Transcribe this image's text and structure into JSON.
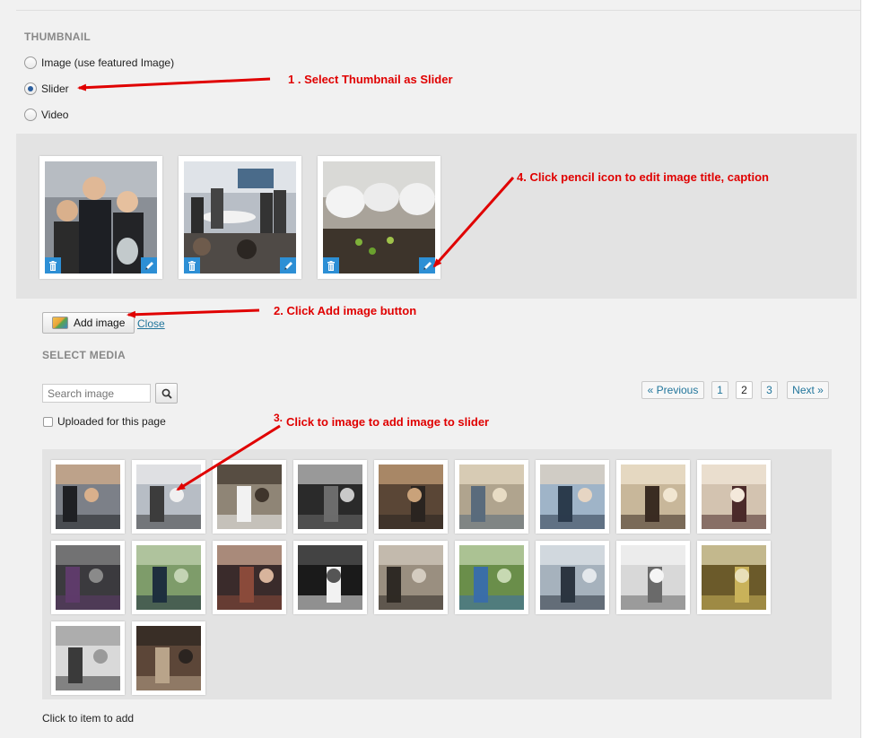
{
  "thumbnail": {
    "title": "THUMBNAIL",
    "options": [
      {
        "label": "Image (use featured Image)",
        "checked": false
      },
      {
        "label": "Slider",
        "checked": true
      },
      {
        "label": "Video",
        "checked": false
      }
    ]
  },
  "slider": {
    "items": [
      {
        "icon": "photo-scientists"
      },
      {
        "icon": "photo-group-meeting"
      },
      {
        "icon": "photo-students-planting"
      }
    ],
    "delete_icon": "trash-icon",
    "edit_icon": "pencil-icon"
  },
  "actions": {
    "add_image_label": "Add image",
    "close_label": "Close"
  },
  "select_media": {
    "title": "SELECT MEDIA",
    "search_placeholder": "Search image",
    "uploaded_checkbox_label": "Uploaded for this page",
    "uploaded_checked": false,
    "pagination": {
      "previous": "« Previous",
      "pages": [
        "1",
        "2",
        "3"
      ],
      "current": "2",
      "next": "Next »"
    },
    "items_count": 20,
    "footer": "Click to item to add"
  },
  "annotations": {
    "step1": "1 . Select Thumbnail as Slider",
    "step2": "2. Click Add image button",
    "step3_num": "3.",
    "step3": "Click to image to add image to slider",
    "step4": "4. Click pencil icon to edit image title, caption"
  },
  "colors": {
    "annotation": "#e00000",
    "link": "#21759b",
    "icon_button": "#2d8fd5"
  }
}
